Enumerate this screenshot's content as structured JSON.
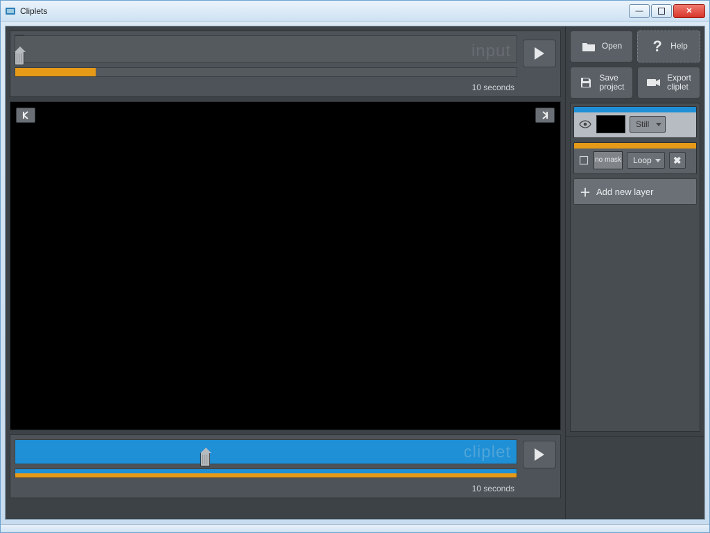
{
  "window": {
    "title": "Cliplets"
  },
  "toolbar": {
    "open": "Open",
    "help": "Help",
    "save_project_line1": "Save",
    "save_project_line2": "project",
    "export_line1": "Export",
    "export_line2": "cliplet"
  },
  "timelines": {
    "input_watermark": "input",
    "cliplet_watermark": "cliplet",
    "input_duration": "10 seconds",
    "cliplet_duration": "10 seconds"
  },
  "layers": {
    "add_label": "Add new layer",
    "items": [
      {
        "accent": "#1f8fd6",
        "mask": "thumb",
        "type": "Still"
      },
      {
        "accent": "#e69a17",
        "mask": "none",
        "mask_label": "no mask",
        "type": "Loop"
      }
    ]
  }
}
